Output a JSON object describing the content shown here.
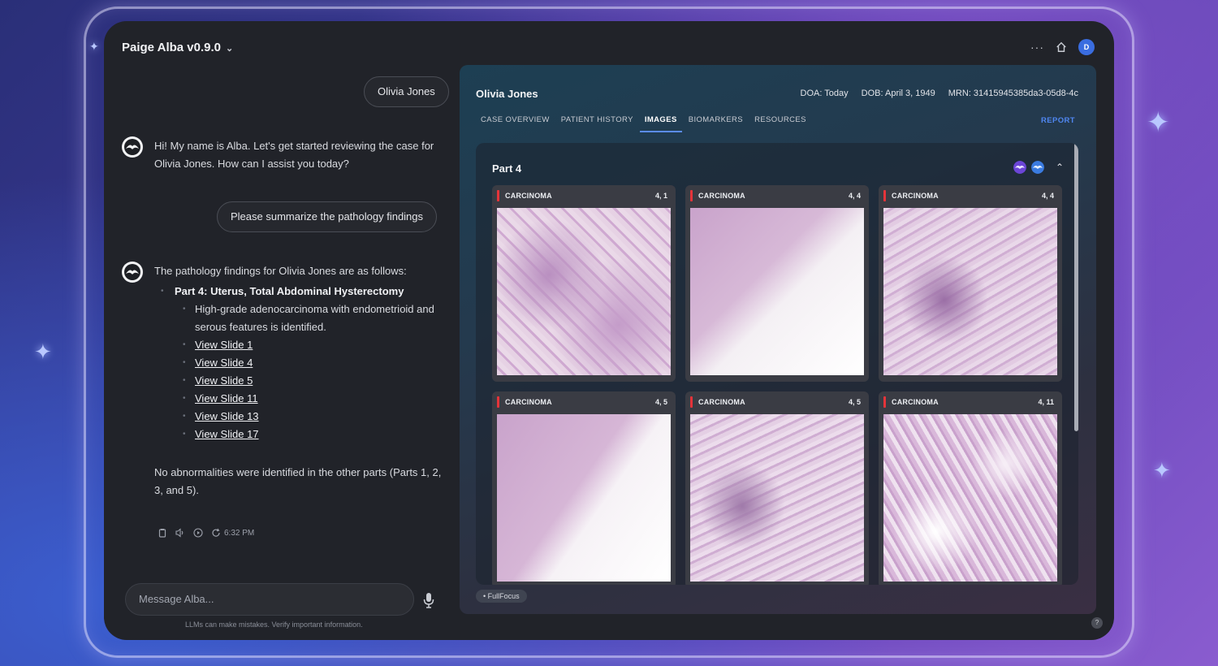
{
  "app": {
    "title": "Paige Alba v0.9.0",
    "avatar_initial": "D",
    "menu_dots": "···"
  },
  "chat": {
    "user_messages": [
      "Olivia Jones",
      "Please summarize the pathology findings"
    ],
    "bot_greeting": "Hi! My name is Alba. Let's get started reviewing the case for Olivia Jones. How can I assist you today?",
    "bot_reply_intro": "The pathology findings for Olivia Jones are as follows:",
    "bot_reply_part": "Part 4: Uterus, Total Abdominal Hysterectomy",
    "bot_reply_finding": "High-grade adenocarcinoma with endometrioid and serous features is identified.",
    "bot_reply_links": [
      "View Slide 1",
      "View Slide 4",
      "View Slide 5",
      "View Slide 11",
      "View Slide 13",
      "View Slide 17"
    ],
    "bot_reply_outro": "No abnormalities were identified in the other parts (Parts 1, 2, 3, and 5).",
    "message_time": "6:32 PM",
    "composer_placeholder": "Message Alba...",
    "disclaimer": "LLMs can make mistakes. Verify important information."
  },
  "case": {
    "patient_name": "Olivia Jones",
    "doa": "DOA: Today",
    "dob": "DOB: April 3, 1949",
    "mrn": "MRN: 31415945385da3-05d8-4c",
    "tabs": [
      "CASE OVERVIEW",
      "PATIENT HISTORY",
      "IMAGES",
      "BIOMARKERS",
      "RESOURCES"
    ],
    "active_tab": "IMAGES",
    "report_label": "REPORT",
    "part_title": "Part 4",
    "slides": [
      {
        "label": "CARCINOMA",
        "id": "4, 1"
      },
      {
        "label": "CARCINOMA",
        "id": "4, 4"
      },
      {
        "label": "CARCINOMA",
        "id": "4, 4"
      },
      {
        "label": "CARCINOMA",
        "id": "4, 5"
      },
      {
        "label": "CARCINOMA",
        "id": "4, 5"
      },
      {
        "label": "CARCINOMA",
        "id": "4, 11"
      }
    ],
    "fullfocus_label": "FullFocus",
    "help_label": "?"
  },
  "colors": {
    "accent_blue": "#4f86f0",
    "flag_red": "#e5343a",
    "tissue_pink": "#d9c1d9"
  }
}
